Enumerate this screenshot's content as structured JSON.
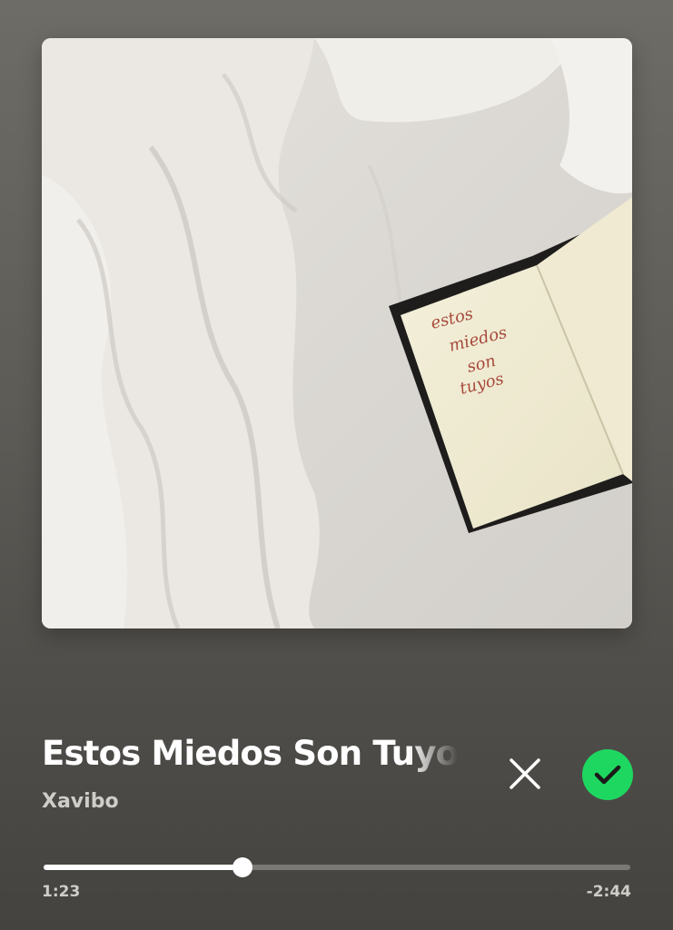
{
  "album_art": {
    "icon": "album-cover-image",
    "handwritten_text": [
      "estos",
      "miedos",
      "son",
      "tuyos"
    ]
  },
  "track": {
    "title": "Estos Miedos Son Tuyos",
    "artist": "Xavibo"
  },
  "actions": {
    "dislike_icon": "close-icon",
    "like_icon": "check-circle-icon",
    "liked": true,
    "like_color": "#1ed760"
  },
  "playback": {
    "elapsed": "1:23",
    "remaining": "-2:44",
    "progress_fraction": 0.339
  }
}
